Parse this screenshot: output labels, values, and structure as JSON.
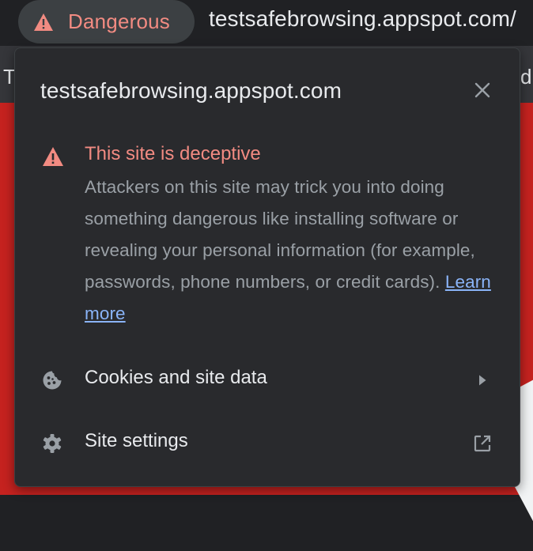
{
  "address_bar": {
    "security_chip_label": "Dangerous",
    "url": "testsafebrowsing.appspot.com/"
  },
  "bookmarks_bar": {
    "left_fragment": "T",
    "right_fragment": "di"
  },
  "popup": {
    "title": "testsafebrowsing.appspot.com",
    "warning": {
      "heading": "This site is deceptive",
      "body": "Attackers on this site may trick you into doing something dangerous like installing software or revealing your personal information (for example, passwords, phone numbers, or credit cards).",
      "link_label": "Learn more"
    },
    "items": [
      {
        "label": "Cookies and site data",
        "icon": "cookie-icon",
        "trail_icon": "arrow-right-icon"
      },
      {
        "label": "Site settings",
        "icon": "gear-icon",
        "trail_icon": "open-in-new-icon"
      }
    ]
  },
  "colors": {
    "danger": "#f28b82",
    "link": "#8ab4f8",
    "popup_bg": "#292a2d",
    "page_bg": "#c5221f"
  }
}
